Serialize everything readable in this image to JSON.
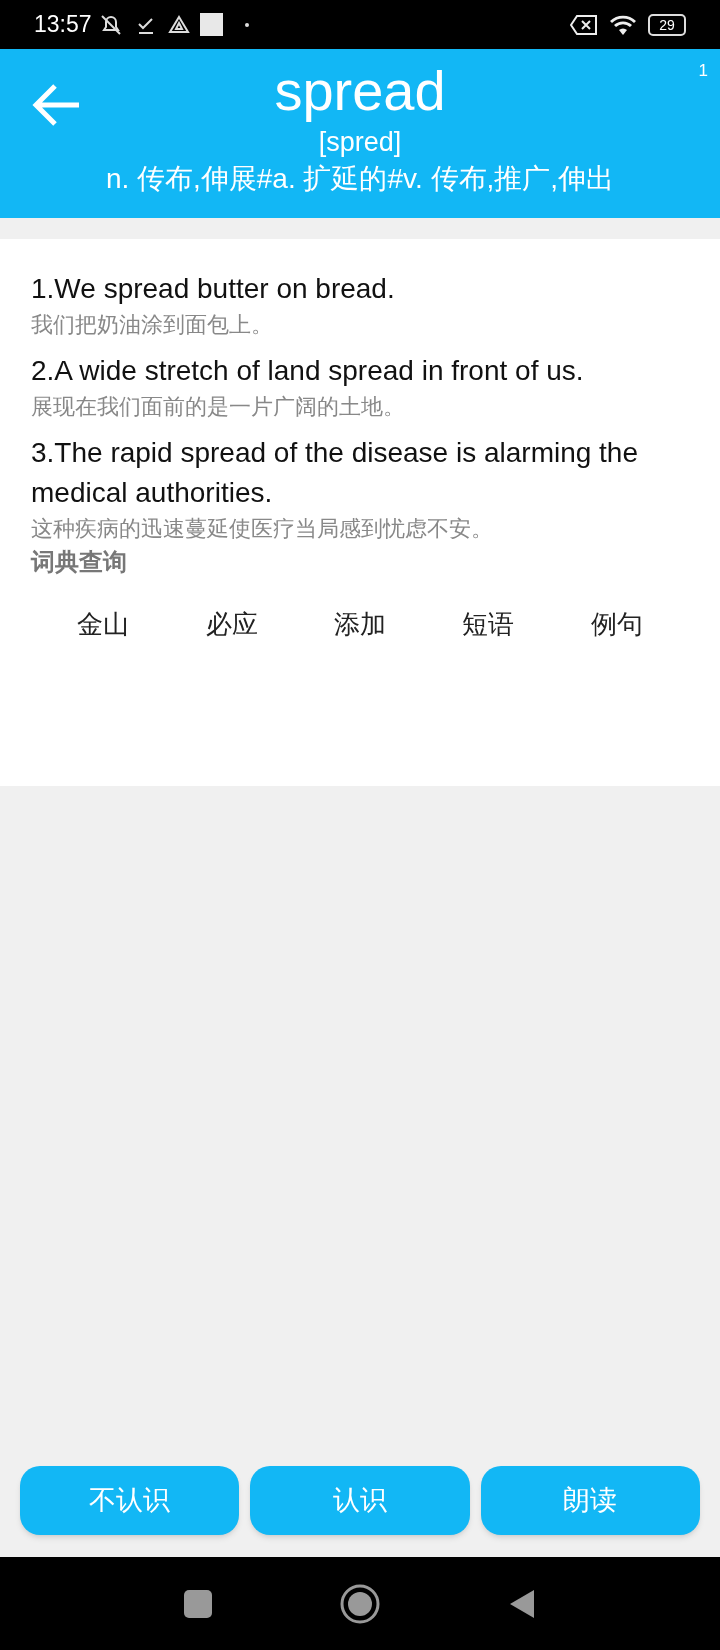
{
  "status_bar": {
    "time": "13:57",
    "battery": "29"
  },
  "header": {
    "word": "spread",
    "phonetic": "[spred]",
    "definition": "n. 传布,伸展#a. 扩延的#v. 传布,推广,伸出",
    "counter": "1"
  },
  "examples": [
    {
      "english": "1.We spread butter on bread.",
      "chinese": "我们把奶油涂到面包上。"
    },
    {
      "english": "2.A wide stretch of land spread in front of us.",
      "chinese": "展现在我们面前的是一片广阔的土地。"
    },
    {
      "english": "3.The rapid spread of the disease is alarming the medical authorities.",
      "chinese": "这种疾病的迅速蔓延使医疗当局感到忧虑不安。"
    }
  ],
  "dictionary": {
    "title": "词典查询",
    "links": [
      "金山",
      "必应",
      "添加",
      "短语",
      "例句"
    ]
  },
  "buttons": [
    "不认识",
    "认识",
    "朗读"
  ]
}
